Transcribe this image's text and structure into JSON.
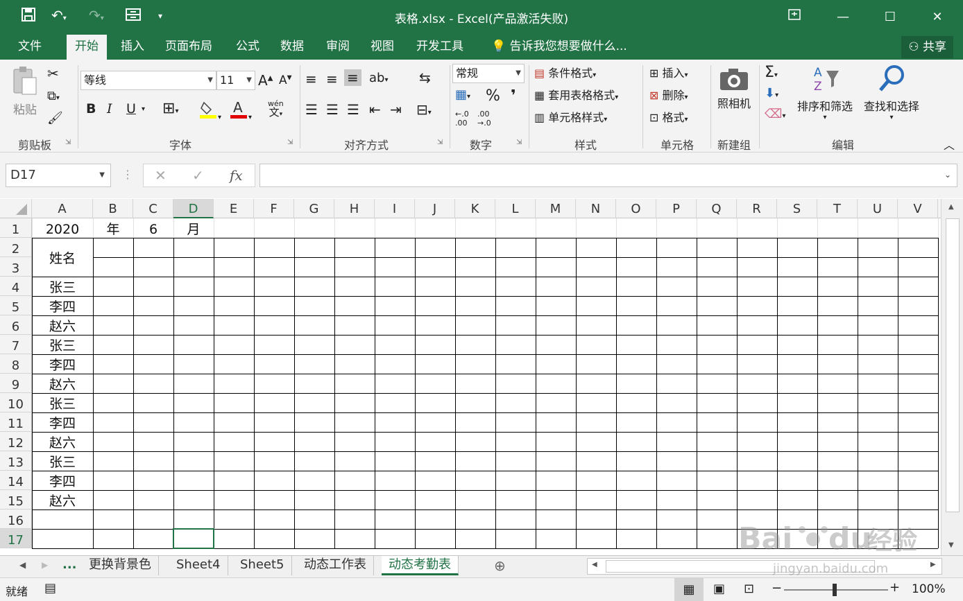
{
  "window": {
    "title": "表格.xlsx - Excel(产品激活失败)"
  },
  "ribbon_tabs": [
    "文件",
    "开始",
    "插入",
    "页面布局",
    "公式",
    "数据",
    "审阅",
    "视图",
    "开发工具"
  ],
  "tell_me": "告诉我您想要做什么...",
  "share_label": "共享",
  "clipboard": {
    "paste": "粘贴",
    "group": "剪贴板"
  },
  "font": {
    "name": "等线",
    "size": "11",
    "group": "字体",
    "bold": "B",
    "italic": "I",
    "underline": "U",
    "wen": "wén"
  },
  "alignment": {
    "group": "对齐方式"
  },
  "number": {
    "format": "常规",
    "percent": "%",
    "comma": "❜",
    "dec_inc": "←.0 .00",
    "dec_dec": ".00 →.0",
    "group": "数字"
  },
  "styles": {
    "conditional": "条件格式",
    "table": "套用表格格式",
    "cell": "单元格样式",
    "group": "样式"
  },
  "cells": {
    "insert": "插入",
    "delete": "删除",
    "format": "格式",
    "group": "单元格"
  },
  "camera": {
    "label": "照相机",
    "group": "新建组"
  },
  "editing": {
    "sort": "排序和筛选",
    "find": "查找和选择",
    "group": "编辑",
    "sigma": "Σ"
  },
  "formula_bar": {
    "name_box": "D17",
    "fx": "fx",
    "value": ""
  },
  "columns": [
    "A",
    "B",
    "C",
    "D",
    "E",
    "F",
    "G",
    "H",
    "I",
    "J",
    "K",
    "L",
    "M",
    "N",
    "O",
    "P",
    "Q",
    "R",
    "S",
    "T",
    "U",
    "V"
  ],
  "rows": [
    "1",
    "2",
    "3",
    "4",
    "5",
    "6",
    "7",
    "8",
    "9",
    "10",
    "11",
    "12",
    "13",
    "14",
    "15",
    "16",
    "17"
  ],
  "cells_data": {
    "a1": "2020",
    "b1": "年",
    "c1": "6",
    "d1": "月",
    "a2": "姓名",
    "names": [
      "张三",
      "李四",
      "赵六",
      "张三",
      "李四",
      "赵六",
      "张三",
      "李四",
      "赵六",
      "张三",
      "李四",
      "赵六"
    ]
  },
  "sheet_tabs": [
    "...",
    "更换背景色",
    "Sheet4",
    "Sheet5",
    "动态工作表",
    "动态考勤表"
  ],
  "active_sheet": "动态考勤表",
  "status": {
    "ready": "就绪",
    "zoom": "100%"
  },
  "watermark": "Baidu经验 jingyan.baidu.com",
  "colors": {
    "excel_green": "#217346",
    "ribbon_bg": "#f3f3f3"
  }
}
